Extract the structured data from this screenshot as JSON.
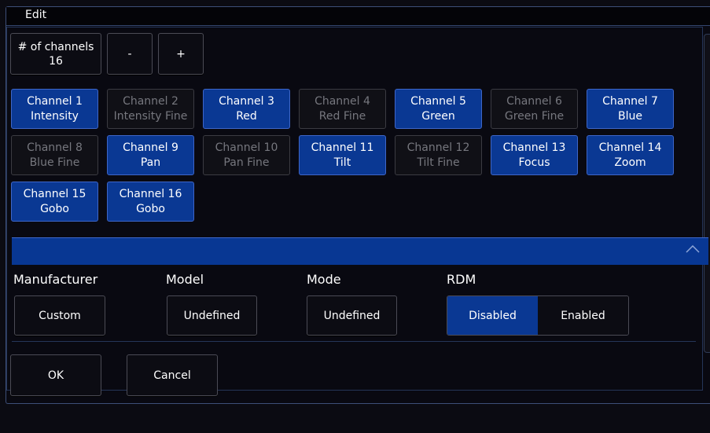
{
  "window": {
    "title": "Edit"
  },
  "channels_control": {
    "count_label": "# of channels",
    "count_value": "16",
    "minus_label": "-",
    "plus_label": "+"
  },
  "channels": [
    {
      "name": "Channel 1",
      "function": "Intensity",
      "active": true
    },
    {
      "name": "Channel 2",
      "function": "Intensity Fine",
      "active": false
    },
    {
      "name": "Channel 3",
      "function": "Red",
      "active": true
    },
    {
      "name": "Channel 4",
      "function": "Red Fine",
      "active": false
    },
    {
      "name": "Channel 5",
      "function": "Green",
      "active": true
    },
    {
      "name": "Channel 6",
      "function": "Green Fine",
      "active": false
    },
    {
      "name": "Channel 7",
      "function": "Blue",
      "active": true
    },
    {
      "name": "Channel 8",
      "function": "Blue Fine",
      "active": false
    },
    {
      "name": "Channel 9",
      "function": "Pan",
      "active": true
    },
    {
      "name": "Channel 10",
      "function": "Pan Fine",
      "active": false
    },
    {
      "name": "Channel 11",
      "function": "Tilt",
      "active": true
    },
    {
      "name": "Channel 12",
      "function": "Tilt Fine",
      "active": false
    },
    {
      "name": "Channel 13",
      "function": "Focus",
      "active": true
    },
    {
      "name": "Channel 14",
      "function": "Zoom",
      "active": true
    },
    {
      "name": "Channel 15",
      "function": "Gobo",
      "active": true
    },
    {
      "name": "Channel 16",
      "function": "Gobo",
      "active": true
    }
  ],
  "collapse_bar": {
    "icon": "chevron-up-icon"
  },
  "properties": {
    "manufacturer": {
      "label": "Manufacturer",
      "value": "Custom"
    },
    "model": {
      "label": "Model",
      "value": "Undefined"
    },
    "mode": {
      "label": "Mode",
      "value": "Undefined"
    },
    "rdm": {
      "label": "RDM",
      "options": [
        "Disabled",
        "Enabled"
      ],
      "selected": "Disabled"
    }
  },
  "actions": {
    "ok_label": "OK",
    "cancel_label": "Cancel"
  },
  "colors": {
    "active_channel": "#0a3893",
    "inactive_channel": "#101016",
    "accent_border": "#3e66c8",
    "background": "#0b0b12"
  }
}
